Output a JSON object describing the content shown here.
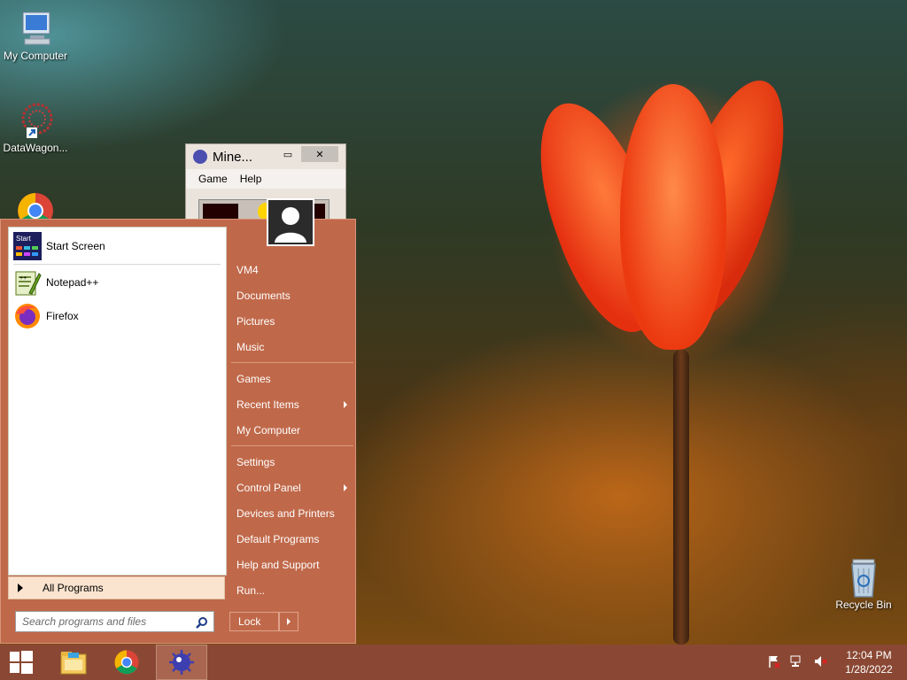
{
  "desktop": {
    "icons": [
      {
        "label": "My Computer",
        "icon": "computer-icon"
      },
      {
        "label": "DataWagon...",
        "icon": "datawagon-icon"
      },
      {
        "label": "",
        "icon": "chrome-icon"
      },
      {
        "label": "Recycle Bin",
        "icon": "recycle-bin-icon"
      }
    ]
  },
  "minesweeper": {
    "title": "Mine...",
    "menu": [
      "Game",
      "Help"
    ],
    "min_label": "▭",
    "close_label": "✕"
  },
  "start_menu": {
    "pinned": [
      {
        "label": "Start Screen",
        "icon": "start-screen-icon"
      },
      {
        "label": "Notepad++",
        "icon": "notepad-plus-plus-icon"
      },
      {
        "label": "Firefox",
        "icon": "firefox-icon"
      }
    ],
    "all_programs": "All Programs",
    "search_placeholder": "Search programs and files",
    "right_items": [
      {
        "label": "VM4"
      },
      {
        "label": "Documents"
      },
      {
        "label": "Pictures"
      },
      {
        "label": "Music"
      },
      {
        "label": "Games"
      },
      {
        "label": "Recent Items",
        "submenu": true
      },
      {
        "label": "My Computer"
      },
      {
        "label": "Settings"
      },
      {
        "label": "Control Panel",
        "submenu": true
      },
      {
        "label": "Devices and Printers"
      },
      {
        "label": "Default Programs"
      },
      {
        "label": "Help and Support"
      },
      {
        "label": "Run..."
      }
    ],
    "lock_label": "Lock"
  },
  "taskbar": {
    "buttons": [
      "start-button-icon",
      "file-explorer-icon",
      "chrome-icon",
      "minesweeper-icon"
    ],
    "time": "12:04 PM",
    "date": "1/28/2022"
  },
  "colors": {
    "start_menu": "#c0694a",
    "taskbar": "#8a4834"
  }
}
